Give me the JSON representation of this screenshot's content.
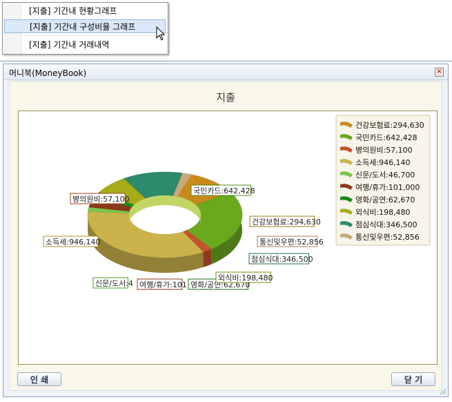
{
  "menu": {
    "items": [
      {
        "label": "[지출] 기간내 현황그래프"
      },
      {
        "label": "[지출] 기간내 구성비율 그래프"
      },
      {
        "label": "[지출] 기간내 거래내역"
      }
    ]
  },
  "window": {
    "title": "머니북(MoneyBook)",
    "print_label": "인 쇄",
    "close_label": "닫 기"
  },
  "chart_data": {
    "type": "pie",
    "title": "지출",
    "donut": true,
    "legend_position": "top-right",
    "series": [
      {
        "name": "건강보험료",
        "value": 294630,
        "color": "#c98a1d"
      },
      {
        "name": "국민카드",
        "value": 642428,
        "color": "#6aa81e"
      },
      {
        "name": "병의원비",
        "value": 57100,
        "color": "#c4522b"
      },
      {
        "name": "소득세",
        "value": 946140,
        "color": "#cbb24b"
      },
      {
        "name": "신문/도서",
        "value": 46700,
        "color": "#7cc64c"
      },
      {
        "name": "여행/휴가",
        "value": 101000,
        "color": "#8a3a18"
      },
      {
        "name": "영화/공연",
        "value": 62670,
        "color": "#1a8a1a"
      },
      {
        "name": "외식비",
        "value": 198480,
        "color": "#a8aa17"
      },
      {
        "name": "점심식대",
        "value": 346500,
        "color": "#2d8a6a"
      },
      {
        "name": "통신및우편",
        "value": 52856,
        "color": "#c8a878"
      }
    ],
    "data_labels": [
      "건강보험료:294,630",
      "국민카드:642,428",
      "병의원비:57,100",
      "소득세:946,140",
      "신문/도서:4",
      "여행/휴가:101",
      "영화/공연:62,670",
      "외식비:198,480",
      "점심식대:346,500",
      "통신및우편:52,856"
    ],
    "legend_labels": [
      "건강보험료:294,630",
      "국민카드:642,428",
      "병의원비:57,100",
      "소득세:946,140",
      "신문/도서:46,700",
      "여행/휴가:101,000",
      "영화/공연:62,670",
      "외식비:198,480",
      "점심식대:346,500",
      "통신및우편:52,856"
    ]
  }
}
